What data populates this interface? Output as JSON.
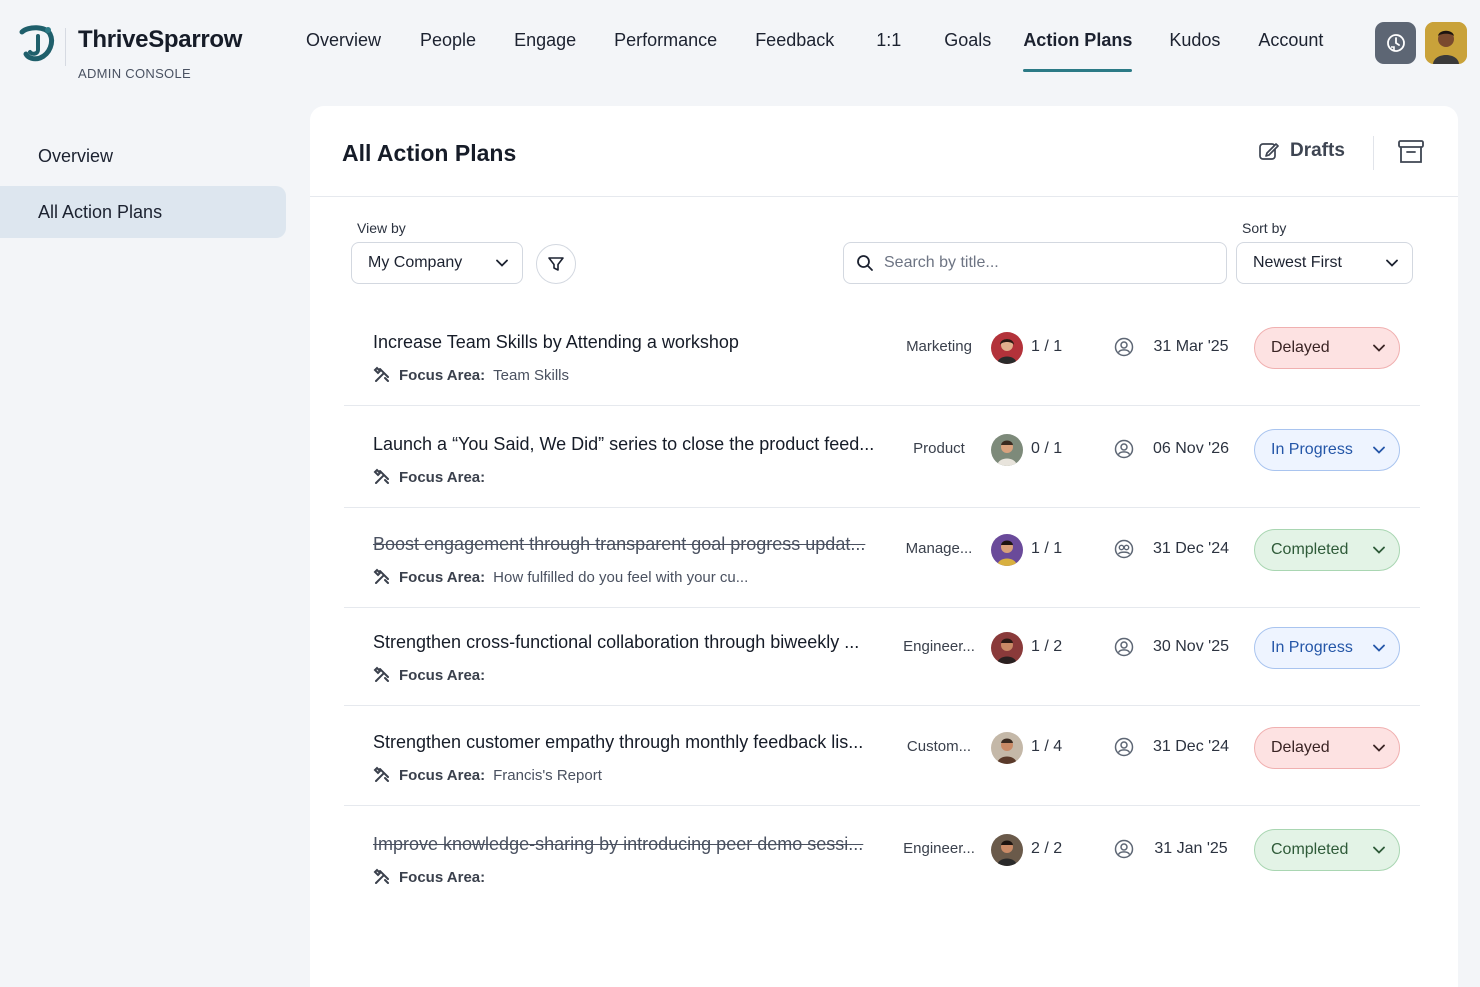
{
  "brand": {
    "name": "ThriveSparrow",
    "subtitle": "ADMIN CONSOLE"
  },
  "nav": {
    "items": [
      {
        "label": "Overview"
      },
      {
        "label": "People"
      },
      {
        "label": "Engage"
      },
      {
        "label": "Performance"
      },
      {
        "label": "Feedback"
      },
      {
        "label": "1:1"
      },
      {
        "label": "Goals"
      },
      {
        "label": "Action Plans",
        "active": true
      },
      {
        "label": "Kudos"
      },
      {
        "label": "Account"
      }
    ]
  },
  "sidebar": {
    "items": [
      {
        "label": "Overview"
      },
      {
        "label": "All Action Plans",
        "active": true
      }
    ]
  },
  "panel": {
    "title": "All Action Plans",
    "drafts_label": "Drafts",
    "view_by_label": "View by",
    "view_by_value": "My Company",
    "sort_by_label": "Sort by",
    "sort_by_value": "Newest First",
    "search_placeholder": "Search by title..."
  },
  "rows": [
    {
      "title": "Increase Team Skills by Attending a workshop",
      "focus_label": "Focus Area:",
      "focus_value": "Team Skills",
      "dept": "Marketing",
      "count": "1 / 1",
      "date": "31 Mar '25",
      "status": "Delayed",
      "status_kind": "delayed",
      "done": false
    },
    {
      "title": "Launch a “You Said, We Did” series to close the product feed...",
      "focus_label": "Focus Area:",
      "focus_value": "",
      "dept": "Product",
      "count": "0 / 1",
      "date": "06 Nov '26",
      "status": "In Progress",
      "status_kind": "progress",
      "done": false
    },
    {
      "title": "Boost engagement through transparent goal progress updat...",
      "focus_label": "Focus Area:",
      "focus_value": "How fulfilled do you feel with your cu...",
      "dept": "Manage...",
      "count": "1 / 1",
      "date": "31 Dec '24",
      "status": "Completed",
      "status_kind": "completed",
      "done": true
    },
    {
      "title": "Strengthen cross-functional collaboration through biweekly ...",
      "focus_label": "Focus Area:",
      "focus_value": "",
      "dept": "Engineer...",
      "count": "1 / 2",
      "date": "30 Nov '25",
      "status": "In Progress",
      "status_kind": "progress",
      "done": false
    },
    {
      "title": "Strengthen customer empathy through monthly feedback lis...",
      "focus_label": "Focus Area:",
      "focus_value": "Francis's Report",
      "dept": "Custom...",
      "count": "1 / 4",
      "date": "31 Dec '24",
      "status": "Delayed",
      "status_kind": "delayed",
      "done": false
    },
    {
      "title": "Improve knowledge-sharing by introducing peer demo sessi...",
      "focus_label": "Focus Area:",
      "focus_value": "",
      "dept": "Engineer...",
      "count": "2 / 2",
      "date": "31 Jan '25",
      "status": "Completed",
      "status_kind": "completed",
      "done": true
    }
  ],
  "colors": {
    "accent": "#2b7a86",
    "delayed_bg": "#fde2e2",
    "progress_bg": "#eef4ff",
    "completed_bg": "#e3f3e6"
  },
  "icons": {
    "logo": "thrivesparrow-logo-icon",
    "settings_button": "clock-refresh-icon",
    "drafts": "edit-icon",
    "archive": "archive-box-icon",
    "filter": "funnel-icon",
    "search": "search-icon",
    "focus": "tools-icon",
    "owner": "user-circle-icon",
    "dropdown": "chevron-down-icon"
  }
}
